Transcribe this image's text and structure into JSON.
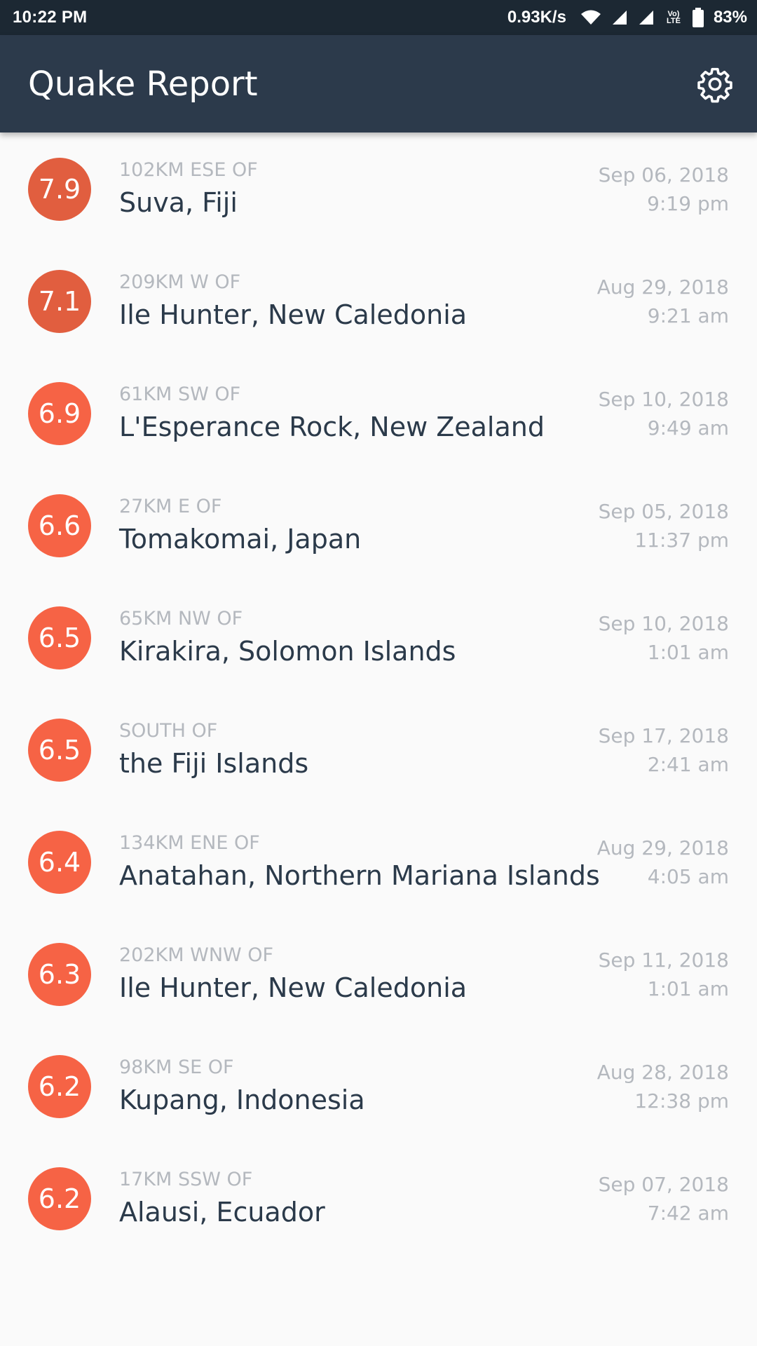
{
  "status_bar": {
    "time": "10:22 PM",
    "network_speed": "0.93K/s",
    "volte_label": "Vo) LTE",
    "battery": "83%",
    "icons": [
      "wifi-icon",
      "signal-icon",
      "signal-icon",
      "volte-icon",
      "battery-icon"
    ]
  },
  "app_bar": {
    "title": "Quake Report",
    "settings_icon": "gear-icon"
  },
  "colors": {
    "app_bar": "#2c3a4b",
    "status_bar": "#1c2833",
    "mag_high": "#e15e3f",
    "mag_mid": "#f66345",
    "mag_low": "#ff6848",
    "primary_text": "#2b3a4a",
    "secondary_text": "#b4b8be"
  },
  "earthquakes": [
    {
      "magnitude": "7.9",
      "offset": "102KM ESE OF",
      "place": "Suva, Fiji",
      "date": "Sep 06, 2018",
      "time": "9:19 pm",
      "color": "#e15e3f"
    },
    {
      "magnitude": "7.1",
      "offset": "209KM W OF",
      "place": "Ile Hunter, New Caledonia",
      "date": "Aug 29, 2018",
      "time": "9:21 am",
      "color": "#e15e3f"
    },
    {
      "magnitude": "6.9",
      "offset": "61KM SW OF",
      "place": "L'Esperance Rock, New Zealand",
      "date": "Sep 10, 2018",
      "time": "9:49 am",
      "color": "#f66345"
    },
    {
      "magnitude": "6.6",
      "offset": "27KM E OF",
      "place": "Tomakomai, Japan",
      "date": "Sep 05, 2018",
      "time": "11:37 pm",
      "color": "#f66345"
    },
    {
      "magnitude": "6.5",
      "offset": "65KM NW OF",
      "place": "Kirakira, Solomon Islands",
      "date": "Sep 10, 2018",
      "time": "1:01 am",
      "color": "#f66345"
    },
    {
      "magnitude": "6.5",
      "offset": "SOUTH OF",
      "place": "the Fiji Islands",
      "date": "Sep 17, 2018",
      "time": "2:41 am",
      "color": "#f66345"
    },
    {
      "magnitude": "6.4",
      "offset": "134KM ENE OF",
      "place": "Anatahan, Northern Mariana Islands",
      "date": "Aug 29, 2018",
      "time": "4:05 am",
      "color": "#f66345"
    },
    {
      "magnitude": "6.3",
      "offset": "202KM WNW OF",
      "place": "Ile Hunter, New Caledonia",
      "date": "Sep 11, 2018",
      "time": "1:01 am",
      "color": "#f66345"
    },
    {
      "magnitude": "6.2",
      "offset": "98KM SE OF",
      "place": "Kupang, Indonesia",
      "date": "Aug 28, 2018",
      "time": "12:38 pm",
      "color": "#f66345"
    },
    {
      "magnitude": "6.2",
      "offset": "17KM SSW OF",
      "place": "Alausi, Ecuador",
      "date": "Sep 07, 2018",
      "time": "7:42 am",
      "color": "#f66345"
    }
  ]
}
